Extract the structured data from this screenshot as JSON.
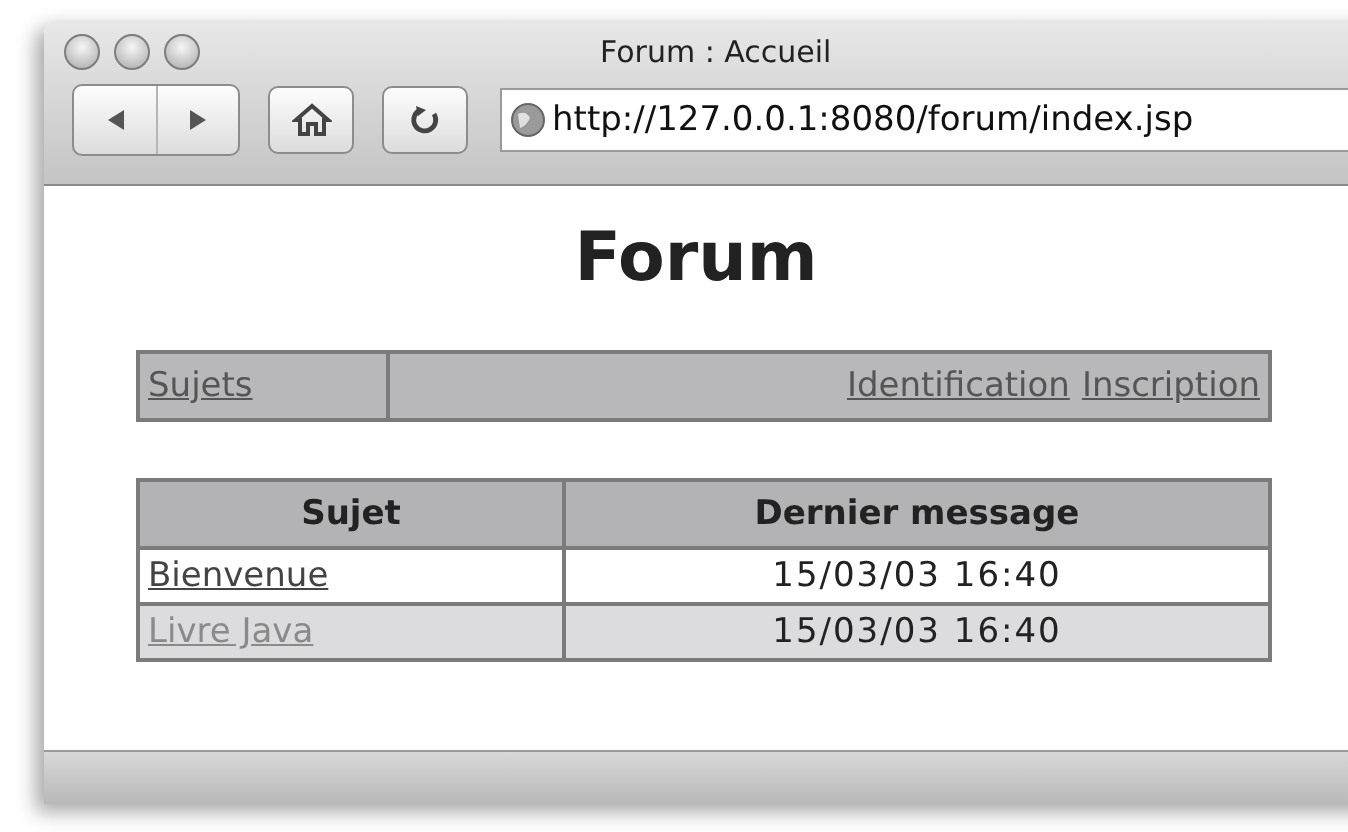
{
  "window": {
    "title": "Forum : Accueil"
  },
  "toolbar": {
    "url": "http://127.0.0.1:8080/forum/index.jsp"
  },
  "page": {
    "heading": "Forum",
    "nav": {
      "left": [
        {
          "label": "Sujets"
        }
      ],
      "right": [
        {
          "label": "Identification"
        },
        {
          "label": "Inscription"
        }
      ]
    },
    "table": {
      "columns": [
        "Sujet",
        "Dernier message"
      ],
      "rows": [
        {
          "subject": "Bienvenue",
          "visited": false,
          "last_message": "15/03/03 16:40"
        },
        {
          "subject": "Livre Java",
          "visited": true,
          "last_message": "15/03/03 16:40"
        }
      ]
    }
  }
}
